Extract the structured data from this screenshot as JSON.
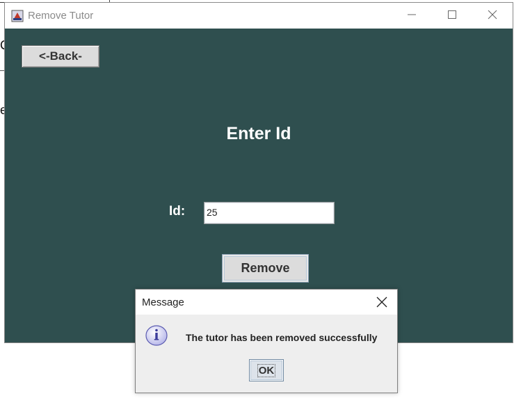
{
  "background": {
    "fragment_top": "C",
    "fragment_mid": "e"
  },
  "window": {
    "title": "Remove Tutor",
    "icon": "java-app-icon",
    "controls": [
      "minimize-icon",
      "maximize-icon",
      "close-icon"
    ],
    "background_color": "#2f4f4f"
  },
  "form": {
    "back_label": "<-Back-",
    "heading": "Enter Id",
    "id_label": "Id:",
    "id_value": "25",
    "remove_label": "Remove"
  },
  "dialog": {
    "title": "Message",
    "icon": "info-icon",
    "message": "The tutor has been removed successfully",
    "ok_label": "OK"
  }
}
